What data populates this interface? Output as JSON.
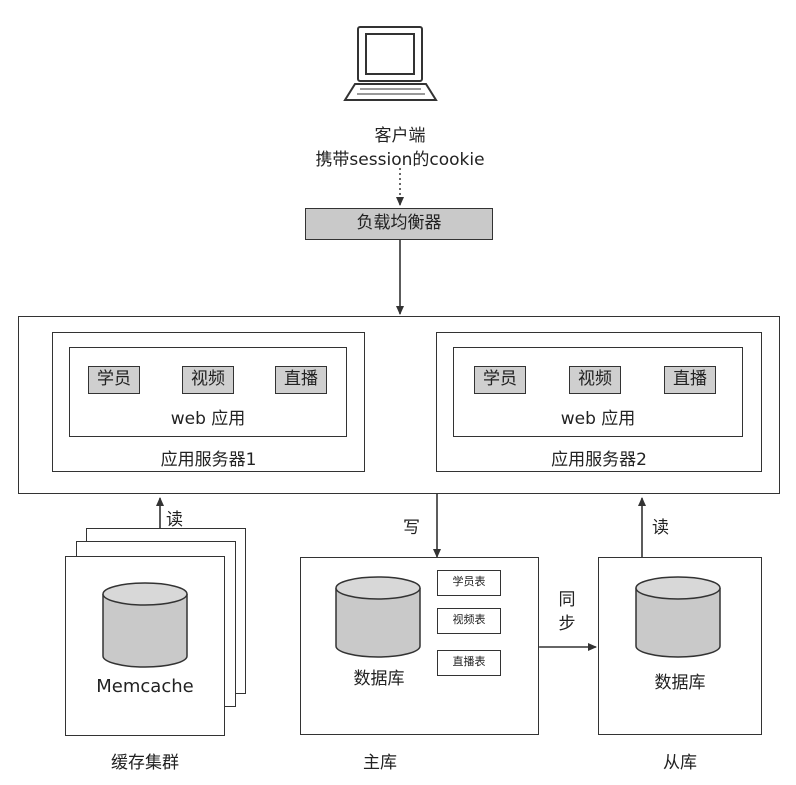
{
  "client": {
    "label": "客户端",
    "note": "携带session的cookie"
  },
  "load_balancer": {
    "label": "负载均衡器"
  },
  "servers": [
    {
      "label": "应用服务器1",
      "app_label": "web 应用",
      "modules": [
        "学员",
        "视频",
        "直播"
      ]
    },
    {
      "label": "应用服务器2",
      "app_label": "web 应用",
      "modules": [
        "学员",
        "视频",
        "直播"
      ]
    }
  ],
  "cache": {
    "name": "Memcache",
    "caption": "缓存集群",
    "arrow_label": "读"
  },
  "master": {
    "db_label": "数据库",
    "caption": "主库",
    "tables": [
      "学员表",
      "视频表",
      "直播表"
    ],
    "arrow_label": "写"
  },
  "slave": {
    "db_label": "数据库",
    "caption": "从库",
    "arrow_label": "读"
  },
  "sync_label": "同\n步"
}
